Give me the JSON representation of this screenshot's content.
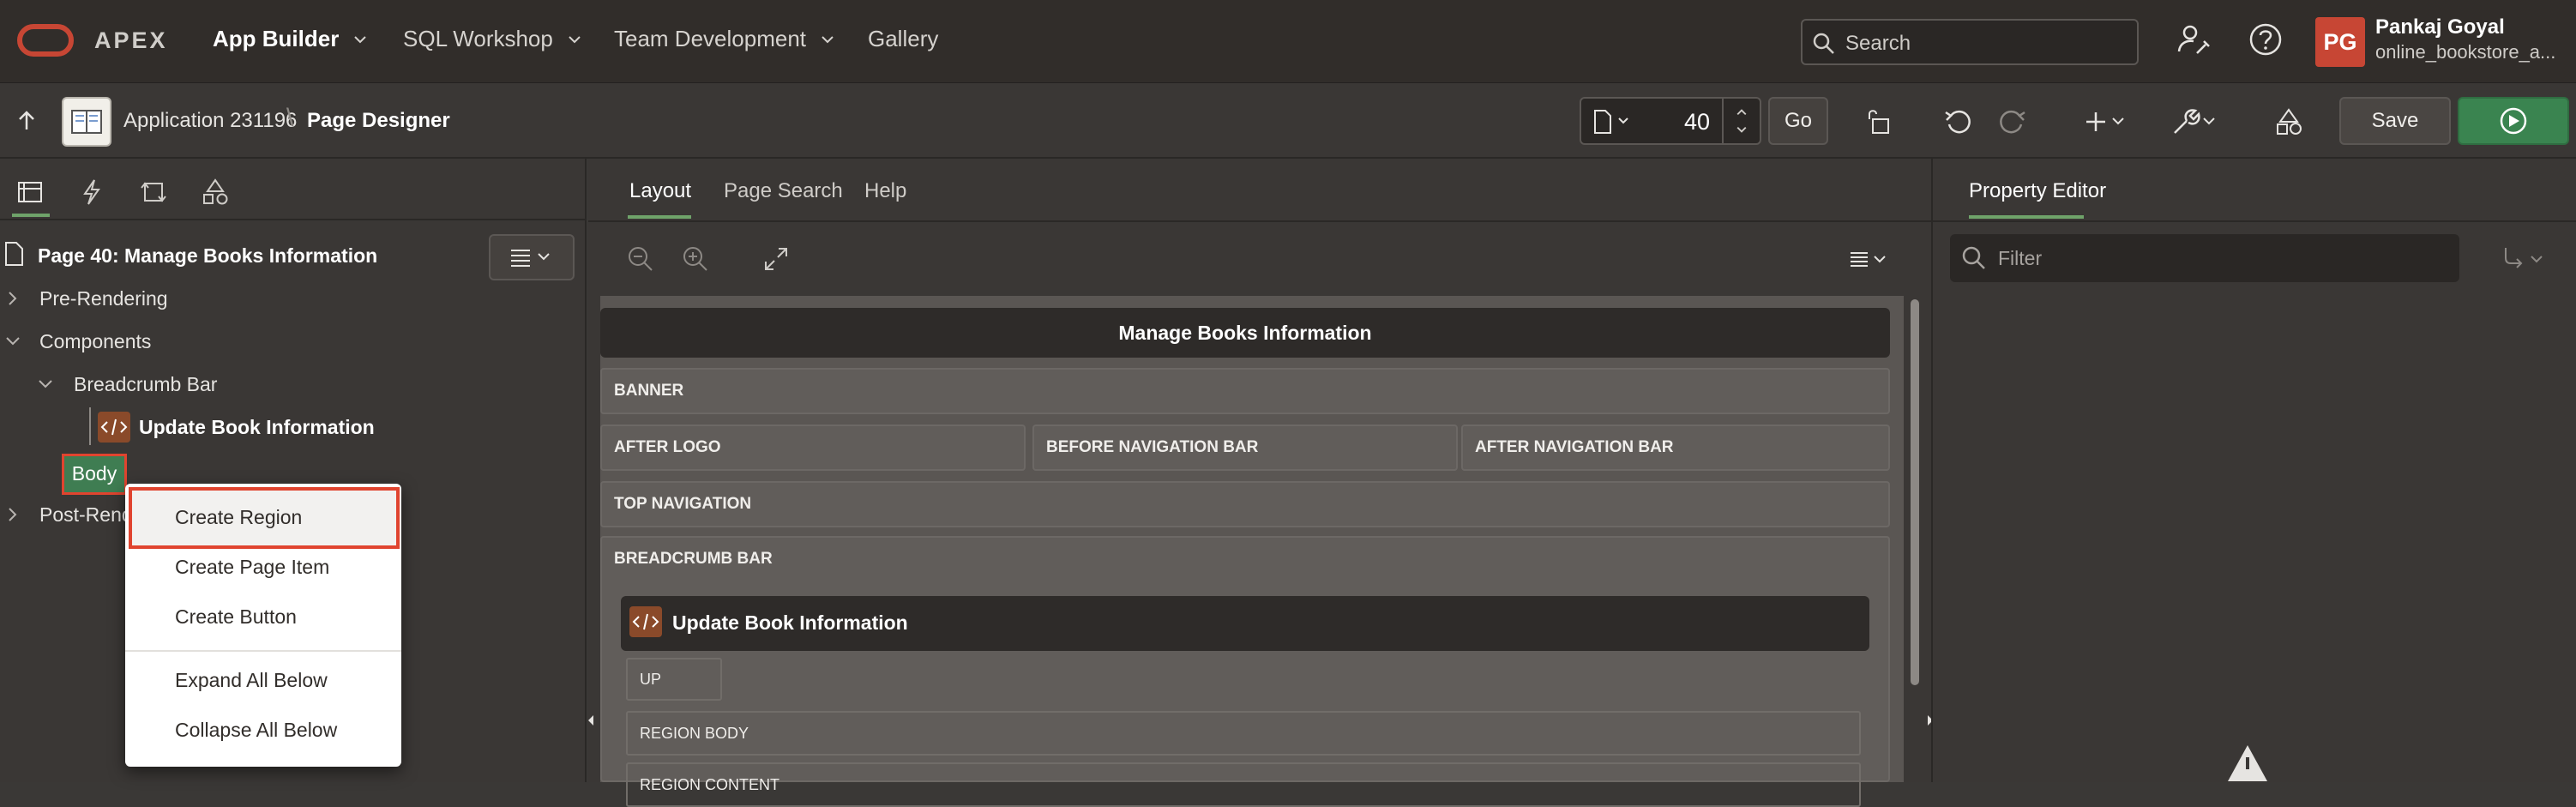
{
  "header": {
    "brand": "APEX",
    "nav": [
      {
        "label": "App Builder",
        "has_menu": true,
        "active": true
      },
      {
        "label": "SQL Workshop",
        "has_menu": true
      },
      {
        "label": "Team Development",
        "has_menu": true
      },
      {
        "label": "Gallery",
        "has_menu": false
      }
    ],
    "search_placeholder": "Search",
    "user_initials": "PG",
    "user_name": "Pankaj Goyal",
    "user_app": "online_bookstore_a..."
  },
  "toolbar": {
    "breadcrumb_app": "Application 231196",
    "breadcrumb_sep": "\\",
    "breadcrumb_page": "Page Designer",
    "page_number": "40",
    "go_label": "Go",
    "save_label": "Save"
  },
  "left_panel": {
    "page_title": "Page 40: Manage Books Information",
    "tree": {
      "pre_rendering": "Pre-Rendering",
      "components": "Components",
      "breadcrumb_bar": "Breadcrumb Bar",
      "update_book": "Update Book Information",
      "body": "Body",
      "post_rendering": "Post-Rend"
    },
    "context_menu": [
      {
        "label": "Create Region",
        "highlighted": true
      },
      {
        "label": "Create Page Item"
      },
      {
        "label": "Create Button"
      },
      {
        "label": "Expand All Below"
      },
      {
        "label": "Collapse All Below"
      }
    ]
  },
  "center_panel": {
    "tabs": [
      "Layout",
      "Page Search",
      "Help"
    ],
    "active_tab": "Layout",
    "page_title": "Manage Books Information",
    "regions": {
      "banner": "BANNER",
      "after_logo": "AFTER LOGO",
      "before_nav": "BEFORE NAVIGATION BAR",
      "after_nav": "AFTER NAVIGATION BAR",
      "top_nav": "TOP NAVIGATION",
      "breadcrumb_bar": "BREADCRUMB BAR",
      "ubi_title": "Update Book Information",
      "up": "UP",
      "region_body": "REGION BODY",
      "region_content": "REGION CONTENT"
    }
  },
  "right_panel": {
    "tab": "Property Editor",
    "filter_placeholder": "Filter"
  },
  "colors": {
    "accent_green": "#3a8450",
    "oracle_red": "#c74634",
    "highlight_red": "#e0442f"
  }
}
